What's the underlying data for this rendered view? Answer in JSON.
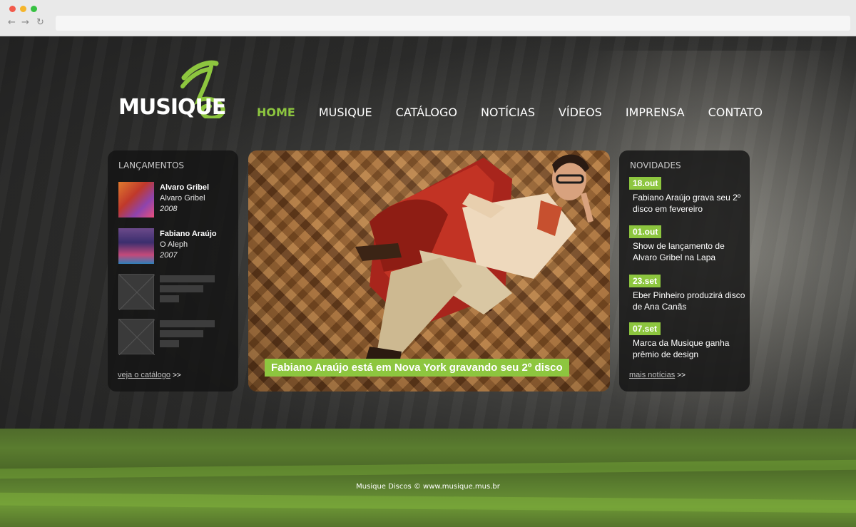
{
  "browser": {
    "back_icon": "arrow-left-icon",
    "forward_icon": "arrow-right-icon",
    "reload_icon": "reload-icon",
    "address": ""
  },
  "logo": {
    "text": "MUSIQUE",
    "accent_color": "#8dc63f"
  },
  "nav": {
    "items": [
      "HOME",
      "MUSIQUE",
      "CATÁLOGO",
      "NOTÍCIAS",
      "VÍDEOS",
      "IMPRENSA",
      "CONTATO"
    ],
    "active": "HOME",
    "active_color": "#8dc63f"
  },
  "releases": {
    "title": "LANÇAMENTOS",
    "items": [
      {
        "artist": "Alvaro Gribel",
        "album": "Alvaro Gribel",
        "year": "2008"
      },
      {
        "artist": "Fabiano Araújo",
        "album": "O Aleph",
        "year": "2007"
      }
    ],
    "more_label": "veja o catálogo",
    "more_arrow": ">>"
  },
  "feature": {
    "caption": "Fabiano Araújo está em Nova York gravando seu 2º disco"
  },
  "news": {
    "title": "NOVIDADES",
    "items": [
      {
        "date": "18.out",
        "text": "Fabiano Araújo grava seu 2º disco em fevereiro"
      },
      {
        "date": "01.out",
        "text": "Show de lançamento de Alvaro Gribel na Lapa"
      },
      {
        "date": "23.set",
        "text": "Eber Pinheiro produzirá disco de  Ana Canãs"
      },
      {
        "date": "07.set",
        "text": "Marca da Musique ganha prêmio de design"
      }
    ],
    "more_label": "mais notícias",
    "more_arrow": ">>"
  },
  "footer": {
    "text": "Musique Discos © www.musique.mus.br"
  }
}
